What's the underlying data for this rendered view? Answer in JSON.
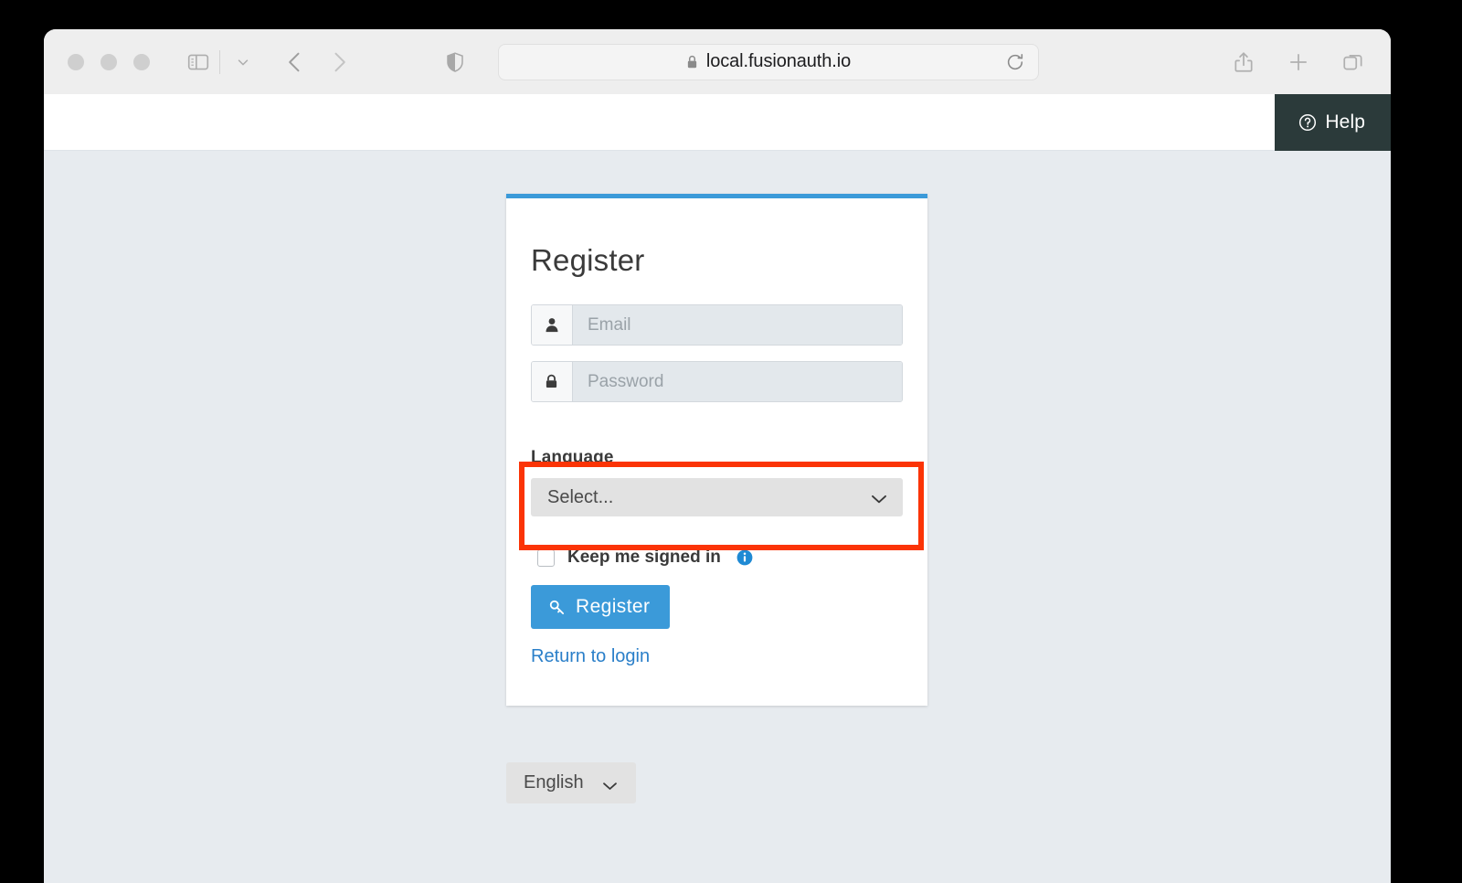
{
  "browser": {
    "traffic_lights": [
      "close",
      "minimize",
      "zoom"
    ],
    "toolbar": {
      "sidebar_icon": "sidebar-icon",
      "sidebar_dropdown_icon": "chevron-down-icon",
      "back_icon": "chevron-left-icon",
      "forward_icon": "chevron-right-icon",
      "shield_icon": "privacy-shield-icon",
      "share_icon": "share-icon",
      "new_tab_icon": "plus-icon",
      "tab_overview_icon": "tab-overview-icon"
    },
    "address_bar": {
      "url": "local.fusionauth.io",
      "lock_icon": "lock-icon",
      "reload_icon": "reload-icon"
    }
  },
  "topnav": {
    "help_label": "Help",
    "help_icon": "question-circle-icon"
  },
  "card": {
    "title": "Register",
    "accent_color": "#3b9ad9",
    "fields": [
      {
        "name": "email",
        "placeholder": "Email",
        "value": "",
        "icon": "user-icon",
        "type": "text"
      },
      {
        "name": "password",
        "placeholder": "Password",
        "value": "",
        "icon": "lock-icon",
        "type": "password"
      }
    ],
    "language": {
      "label": "Language",
      "selected": "Select...",
      "chevron_icon": "chevron-down-icon",
      "highlight_color": "#fb3406"
    },
    "keep_signed_in": {
      "label": "Keep me signed in",
      "checked": false,
      "info_icon": "info-circle-icon"
    },
    "submit": {
      "label": "Register",
      "icon": "key-icon"
    },
    "return_link": "Return to login"
  },
  "locale_selector": {
    "selected": "English",
    "chevron_icon": "chevron-down-icon"
  }
}
